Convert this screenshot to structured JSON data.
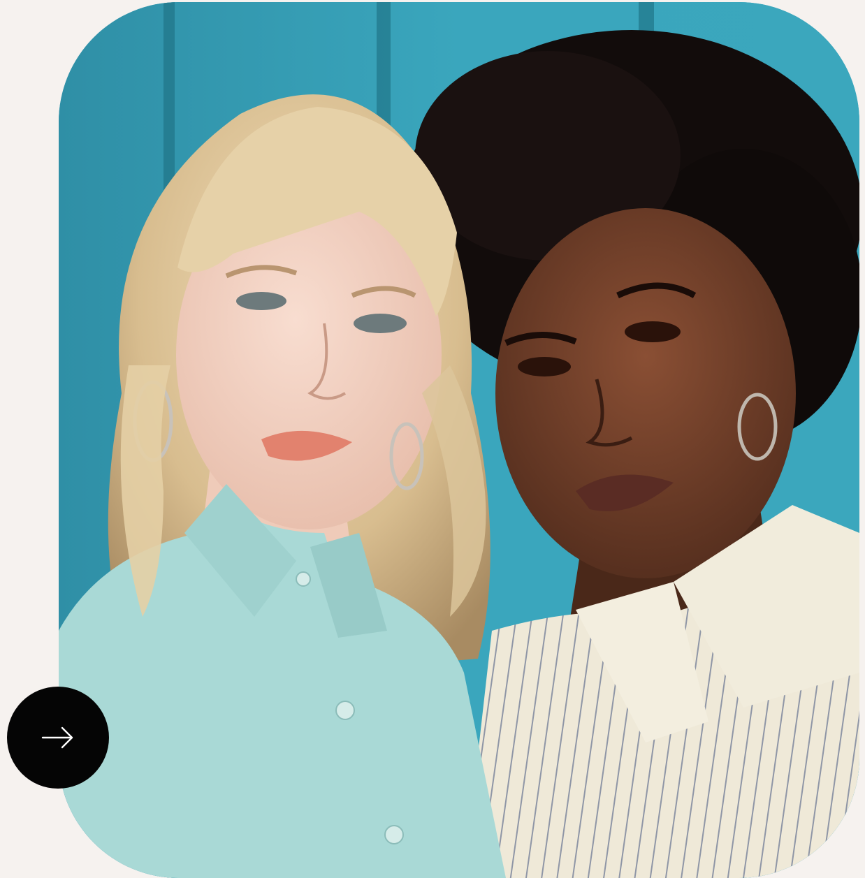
{
  "photo": {
    "alt": "",
    "background_color": "#38a5bc",
    "left_subject_shirt_color": "#a9d9d6",
    "right_subject_shirt_color": "#efeadb"
  },
  "action_button": {
    "icon": "arrow-right-icon",
    "background_color": "#050505",
    "icon_color": "#ffffff"
  },
  "page": {
    "background_color": "#f6f2ef"
  }
}
